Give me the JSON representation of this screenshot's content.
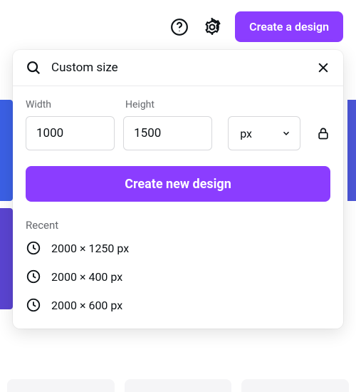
{
  "top_bar": {
    "create_label": "Create a design"
  },
  "panel": {
    "search_text": "Custom size",
    "width_label": "Width",
    "height_label": "Height",
    "width_value": "1000",
    "height_value": "1500",
    "unit_selected": "px",
    "create_button_label": "Create new design",
    "recent_label": "Recent",
    "recent": [
      {
        "label": "2000 × 1250 px"
      },
      {
        "label": "2000 × 400 px"
      },
      {
        "label": "2000 × 600 px"
      }
    ]
  },
  "colors": {
    "accent": "#8b3dff"
  }
}
